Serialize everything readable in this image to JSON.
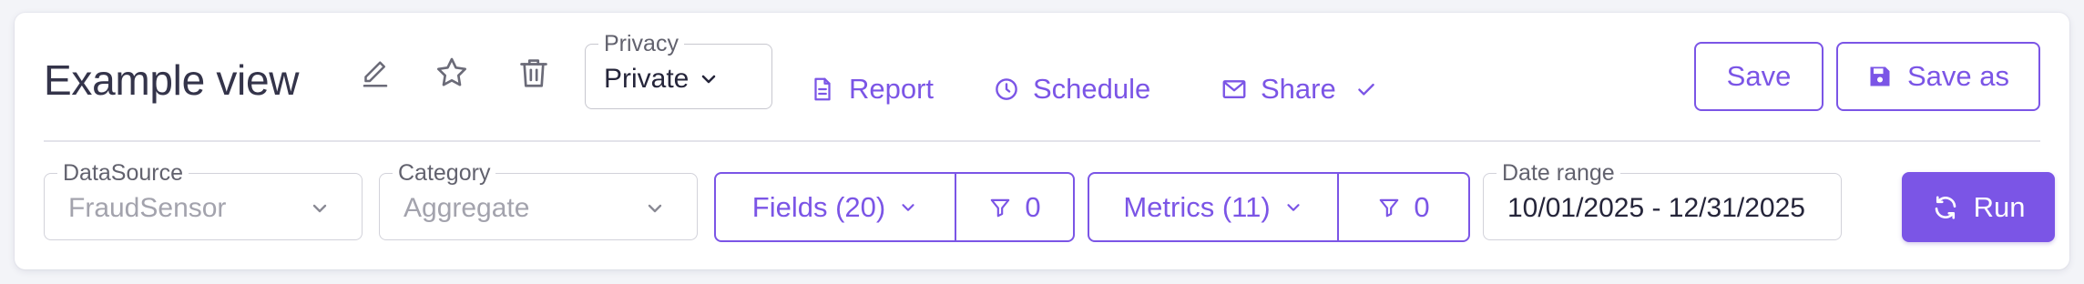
{
  "header": {
    "title": "Example view",
    "privacy": {
      "legend": "Privacy",
      "value": "Private"
    },
    "actions": {
      "report": "Report",
      "schedule": "Schedule",
      "share": "Share"
    },
    "save_label": "Save",
    "save_as_label": "Save as"
  },
  "filters": {
    "datasource": {
      "legend": "DataSource",
      "value": "FraudSensor"
    },
    "category": {
      "legend": "Category",
      "value": "Aggregate"
    },
    "fields": {
      "label": "Fields (20)",
      "filter_count": "0"
    },
    "metrics": {
      "label": "Metrics (11)",
      "filter_count": "0"
    },
    "date_range": {
      "legend": "Date range",
      "value": "10/01/2025 - 12/31/2025"
    },
    "run_label": "Run"
  },
  "colors": {
    "accent": "#7b55e6",
    "text": "#34344a",
    "muted": "#a3a3ad",
    "border": "#d2d2da"
  },
  "icons": [
    "pencil-icon",
    "star-icon",
    "trash-icon",
    "chevron-down-icon",
    "document-icon",
    "clock-icon",
    "mail-icon",
    "check-icon",
    "floppy-disk-icon",
    "filter-icon",
    "refresh-icon"
  ]
}
